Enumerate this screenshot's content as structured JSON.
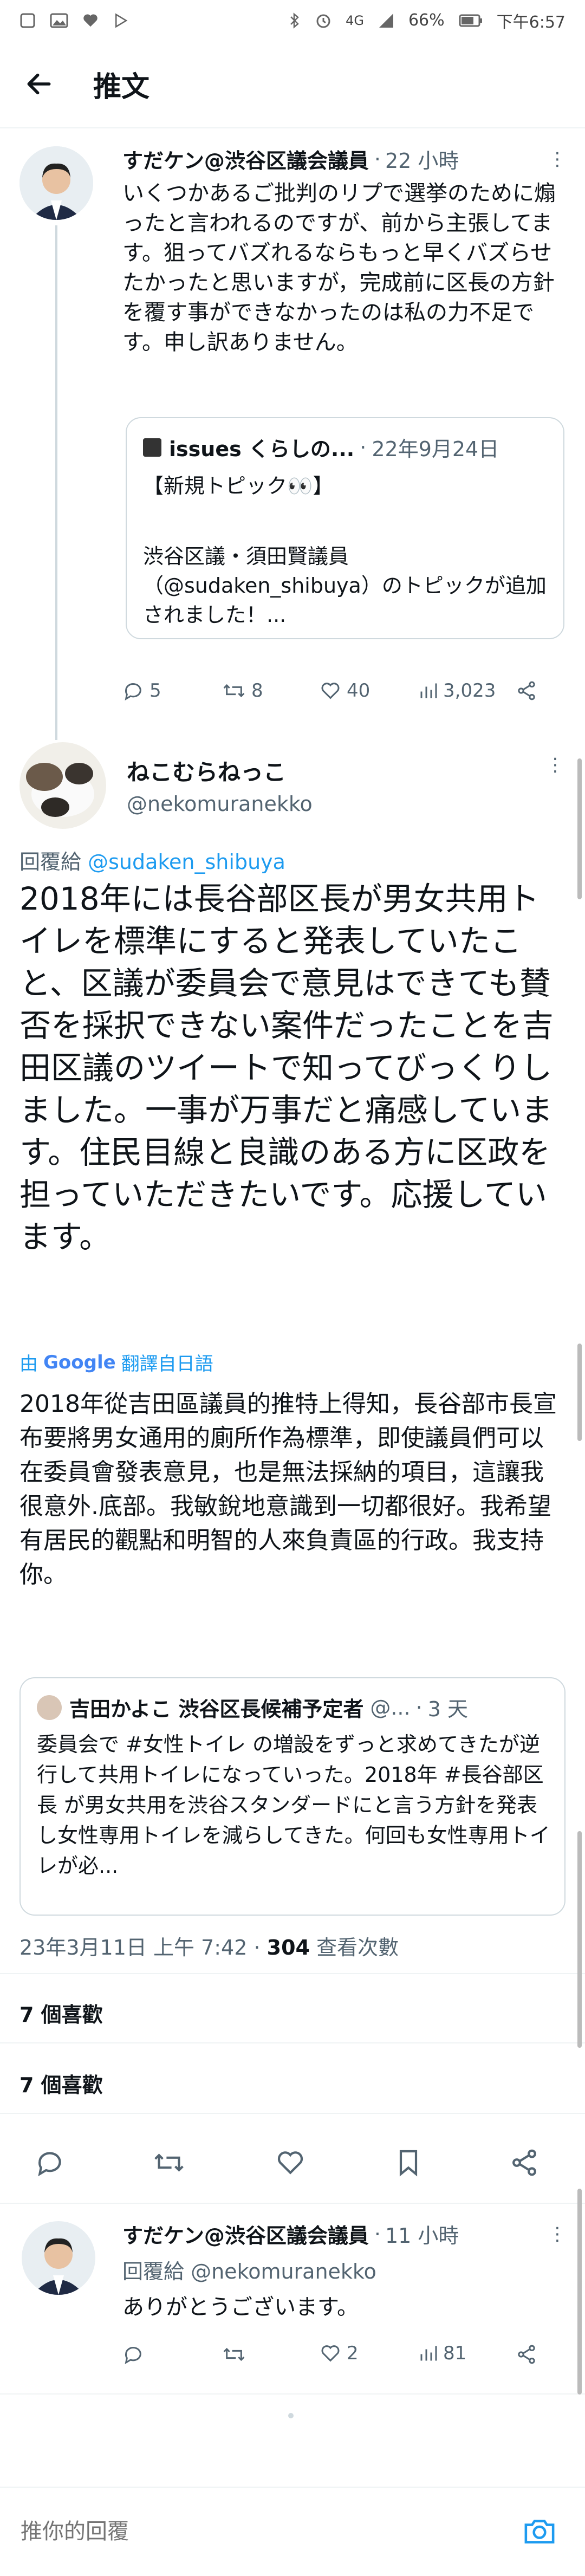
{
  "status_bar": {
    "battery": "66%",
    "time": "下午6:57",
    "signal": "4G"
  },
  "app_bar": {
    "title": "推文"
  },
  "parent_tweet": {
    "author": "すだケン@渋谷区議会議員",
    "time": "22 小時",
    "text": "いくつかあるご批判のリプで選挙のために煽ったと言われるのですが、前から主張してます。狙ってバズれるならもっと早くバズらせたかったと思いますが，完成前に区長の方針を覆す事ができなかったのは私の力不足です。申し訳ありません。",
    "quote": {
      "source": "issues くらしの...",
      "date": "22年9月24日",
      "line1": "【新規トピック👀】",
      "line2": "渋谷区議・須田賢議員（@sudaken_shibuya）のトピックが追加されました！..."
    },
    "stats": {
      "replies": "5",
      "retweets": "8",
      "likes": "40",
      "views": "3,023"
    }
  },
  "main_tweet": {
    "author": "ねこむらねっこ",
    "handle": "@nekomuranekko",
    "reply_to_label": "回覆給",
    "reply_to_handle": "@sudaken_shibuya",
    "text": "2018年には長谷部区長が男女共用トイレを標準にすると発表していたこと、区議が委員会で意見はできても賛否を採択できない案件だったことを吉田区議のツイートで知ってびっくりしました。一事が万事だと痛感しています。住民目線と良識のある方に区政を担っていただきたいです。応援しています。",
    "translate_by": "由",
    "translate_brand": "Google",
    "translate_label": "翻譯自日語",
    "translation": "2018年從吉田區議員的推特上得知，長谷部市長宣布要將男女通用的廁所作為標準，即使議員們可以在委員會發表意見，也是無法採納的項目，這讓我很意外.底部。我敏銳地意識到一切都很好。我希望有居民的觀點和明智的人來負責區的行政。我支持你。",
    "quote": {
      "author": "吉田かよこ 渋谷区長候補予定者",
      "handle": "@...",
      "time": "3 天",
      "text": "委員会で #女性トイレ の増設をずっと求めてきたが逆行して共用トイレになっていった。2018年 #長谷部区長 が男女共用を渋谷スタンダードにと言う方針を発表し女性専用トイレを減らしてきた。何回も女性専用トイレが必..."
    },
    "timestamp": "23年3月11日 上午 7:42",
    "views_count": "304",
    "views_label": "查看次數",
    "likes_row_1": "7 個喜歡",
    "likes_row_2": "7 個喜歡"
  },
  "reply_tweet": {
    "author": "すだケン@渋谷区議会議員",
    "time": "11 小時",
    "reply_to": "回覆給 @nekomuranekko",
    "text": "ありがとうございます。",
    "stats": {
      "likes": "2",
      "views": "81"
    }
  },
  "compose": {
    "placeholder": "推你的回覆"
  },
  "colors": {
    "accent": "#1d9bf0",
    "text": "#0f1419",
    "muted": "#536471"
  }
}
